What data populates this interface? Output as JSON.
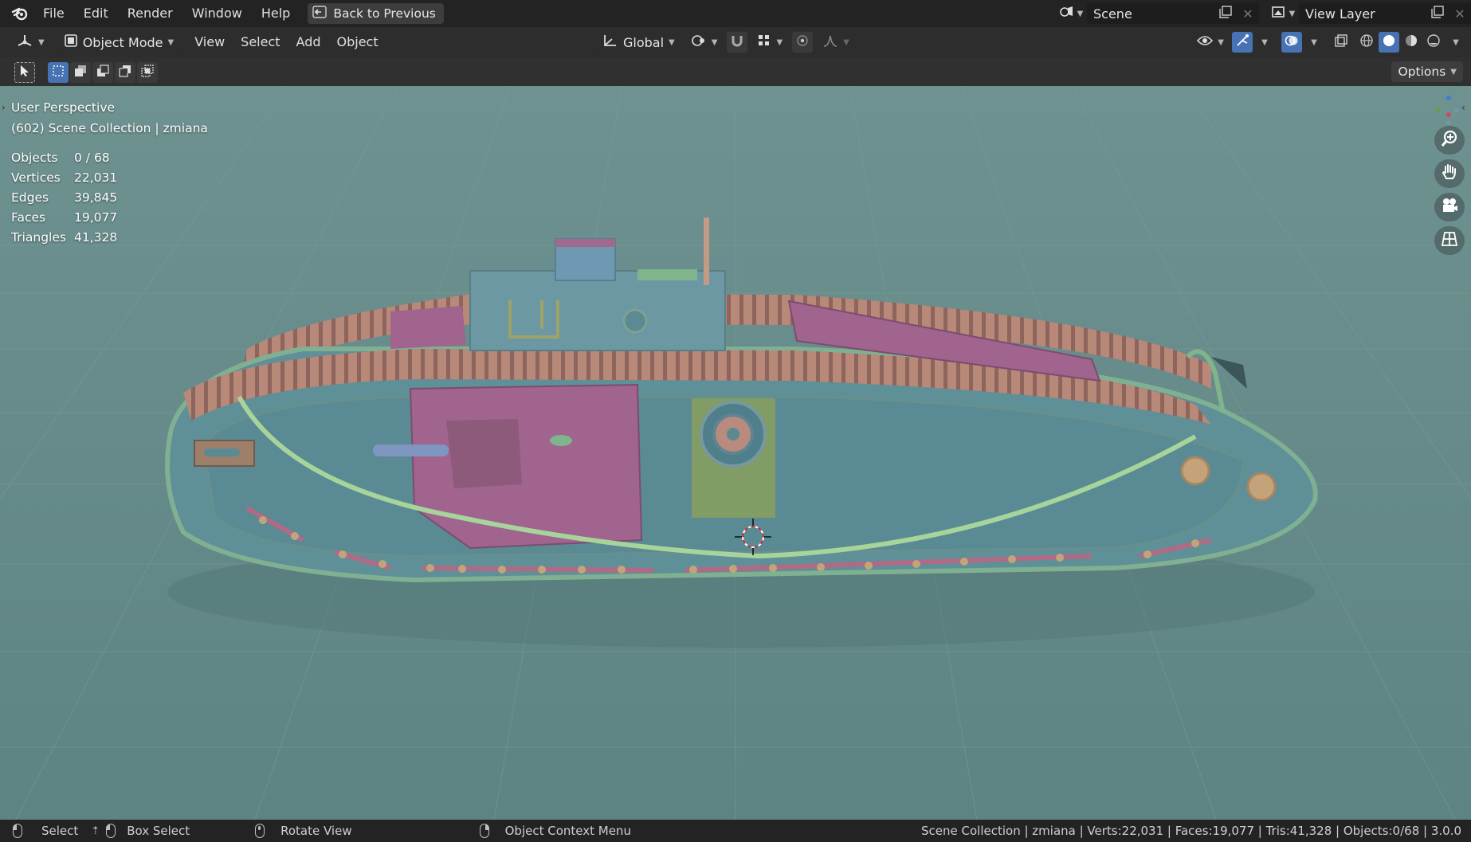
{
  "topbar": {
    "menu": [
      "File",
      "Edit",
      "Render",
      "Window",
      "Help"
    ],
    "back_label": "Back to Previous",
    "scene_label": "Scene",
    "view_layer_label": "View Layer"
  },
  "header": {
    "mode_label": "Object Mode",
    "menu": [
      "View",
      "Select",
      "Add",
      "Object"
    ],
    "orientation_label": "Global"
  },
  "toolbar": {
    "options_label": "Options"
  },
  "viewport": {
    "view_name": "User Perspective",
    "collection_info": "(602) Scene Collection | zmiana",
    "stats": [
      {
        "label": "Objects",
        "value": "0 / 68"
      },
      {
        "label": "Vertices",
        "value": "22,031"
      },
      {
        "label": "Edges",
        "value": "39,845"
      },
      {
        "label": "Faces",
        "value": "19,077"
      },
      {
        "label": "Triangles",
        "value": "41,328"
      }
    ],
    "nav_icons": [
      "zoom-icon",
      "hand-pan-icon",
      "camera-icon",
      "grid-ortho-icon"
    ]
  },
  "statusbar": {
    "select": "Select",
    "box_select": "Box Select",
    "rotate_view": "Rotate View",
    "context_menu": "Object Context Menu",
    "info": "Scene Collection | zmiana | Verts:22,031 | Faces:19,077 | Tris:41,328 | Objects:0/68 | 3.0.0"
  },
  "colors": {
    "accent": "#4772b3",
    "viewport_bg": "#66898b",
    "hull": "#5f8f97",
    "track": "#b98a7e",
    "sponson": "#a0648e"
  }
}
